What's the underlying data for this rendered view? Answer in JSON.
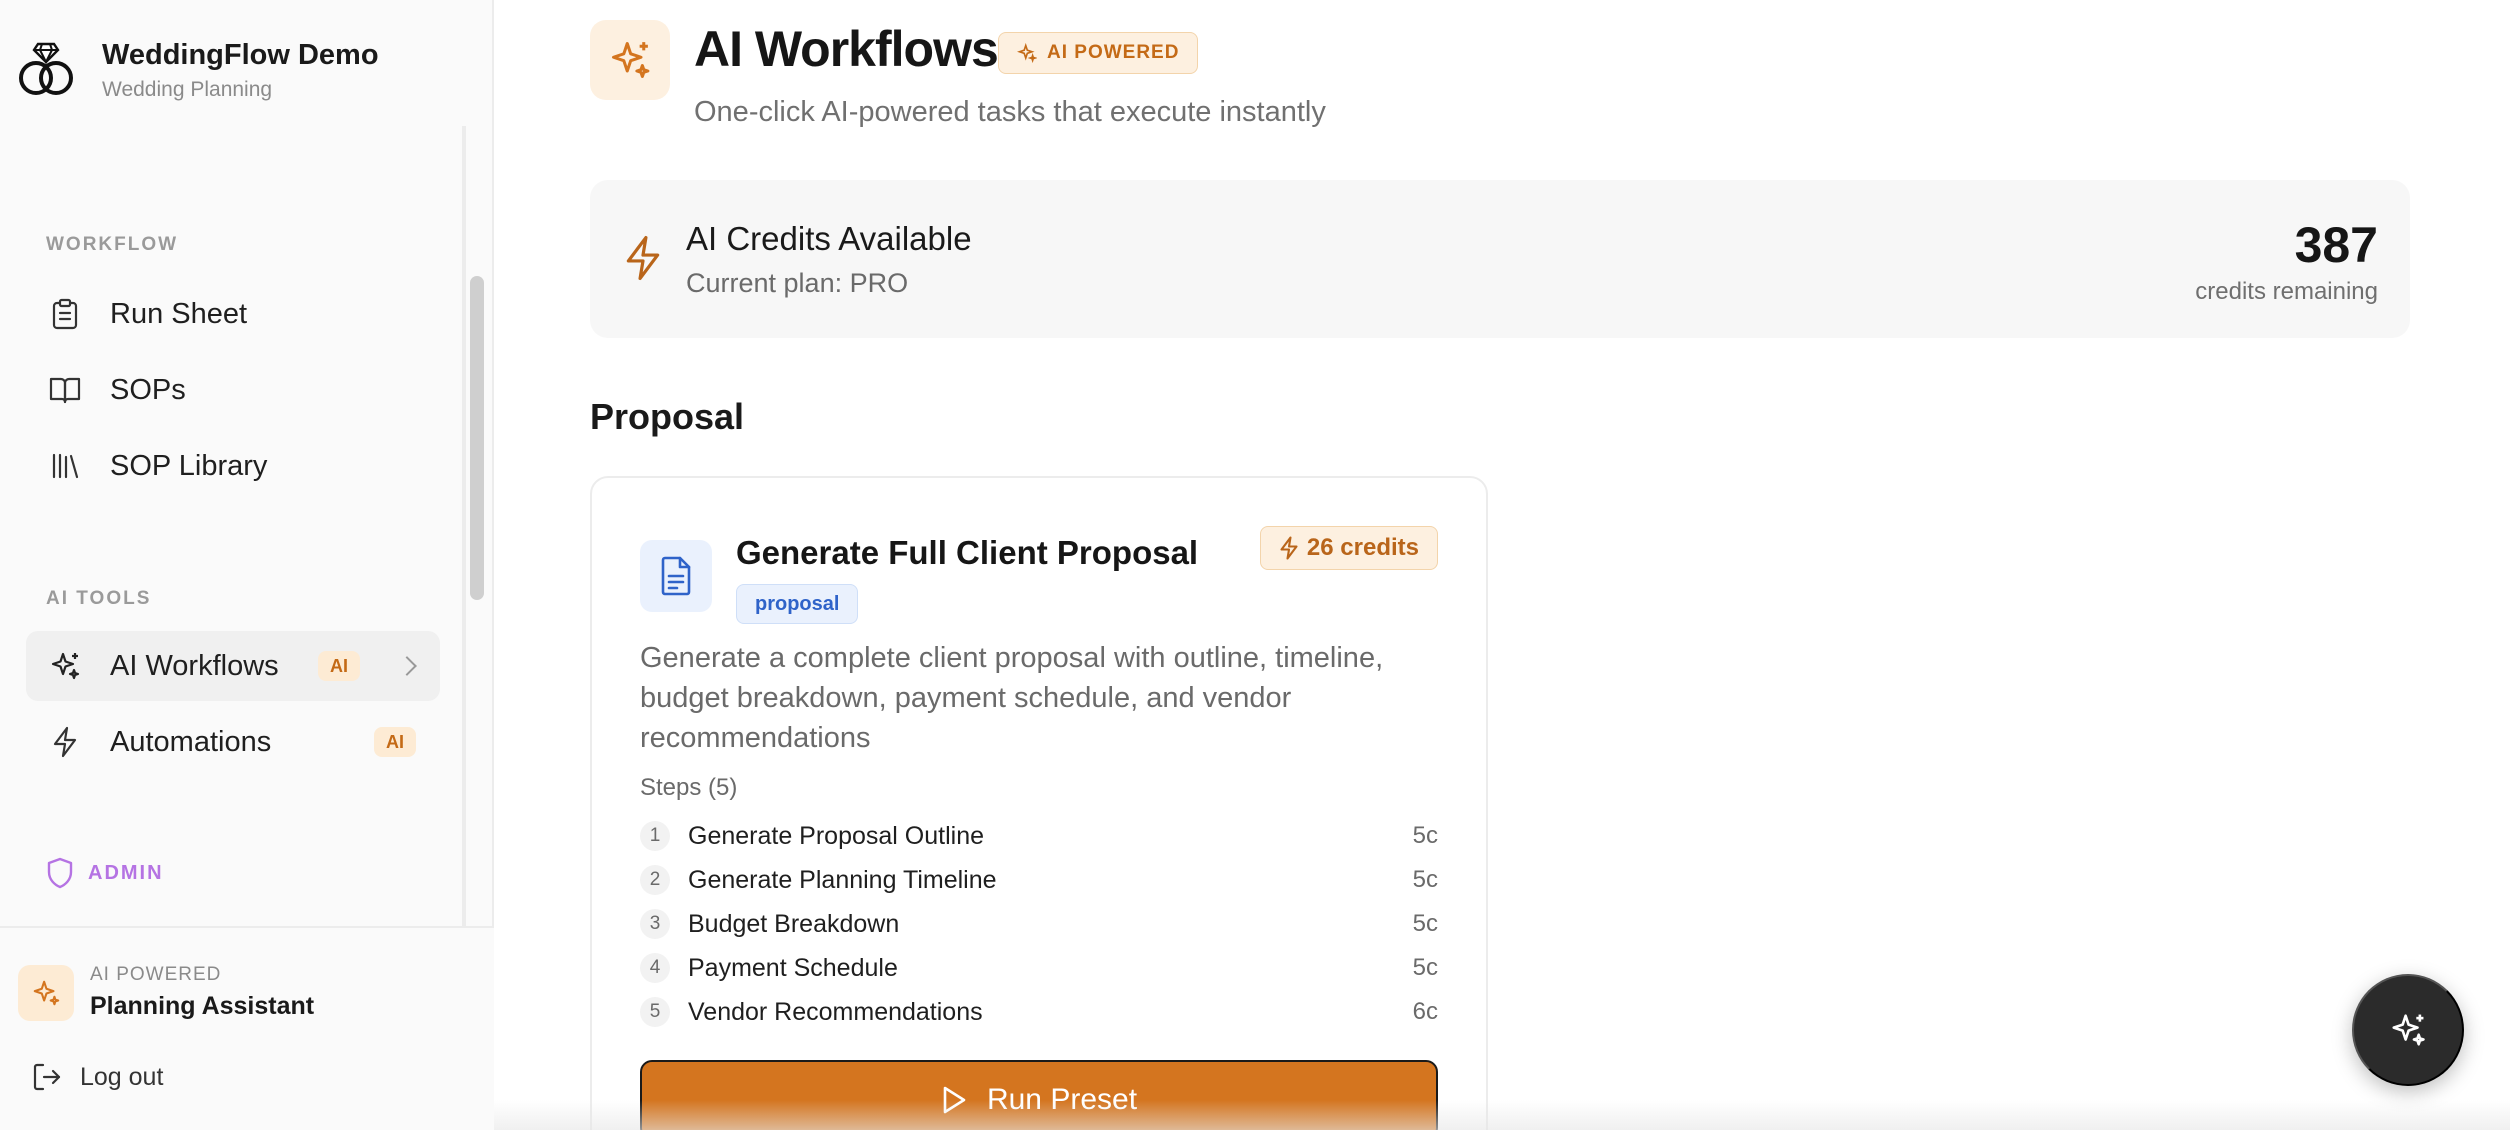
{
  "brand": {
    "title": "WeddingFlow Demo",
    "subtitle": "Wedding Planning"
  },
  "sidebar": {
    "workflow_label": "WORKFLOW",
    "workflow_items": [
      {
        "label": "Run Sheet",
        "icon": "clipboard-icon"
      },
      {
        "label": "SOPs",
        "icon": "book-icon"
      },
      {
        "label": "SOP Library",
        "icon": "library-icon"
      }
    ],
    "ai_tools_label": "AI TOOLS",
    "ai_items": [
      {
        "label": "AI Workflows",
        "badge": "AI",
        "icon": "sparkles-icon",
        "active": true
      },
      {
        "label": "Automations",
        "badge": "AI",
        "icon": "bolt-icon"
      }
    ],
    "admin_label": "ADMIN"
  },
  "assistant": {
    "kicker": "AI POWERED",
    "title": "Planning Assistant"
  },
  "logout_label": "Log out",
  "header": {
    "title": "AI Workflows",
    "badge": "AI POWERED",
    "subtitle": "One-click AI-powered tasks that execute instantly"
  },
  "credits": {
    "title": "AI Credits Available",
    "plan": "Current plan: PRO",
    "count": "387",
    "remaining_label": "credits remaining"
  },
  "section_title": "Proposal",
  "preset": {
    "title": "Generate Full Client Proposal",
    "tag": "proposal",
    "credits": "26 credits",
    "description": "Generate a complete client proposal with outline, timeline, budget breakdown, payment schedule, and vendor recommendations",
    "steps_label": "Steps (5)",
    "steps": [
      {
        "num": "1",
        "label": "Generate Proposal Outline",
        "cost": "5c"
      },
      {
        "num": "2",
        "label": "Generate Planning Timeline",
        "cost": "5c"
      },
      {
        "num": "3",
        "label": "Budget Breakdown",
        "cost": "5c"
      },
      {
        "num": "4",
        "label": "Payment Schedule",
        "cost": "5c"
      },
      {
        "num": "5",
        "label": "Vendor Recommendations",
        "cost": "6c"
      }
    ],
    "run_label": "Run Preset"
  },
  "colors": {
    "accent": "#d4751f",
    "accent_soft": "#fdf0e0",
    "tag_blue": "#2f63c9",
    "admin_purple": "#b573e3"
  }
}
